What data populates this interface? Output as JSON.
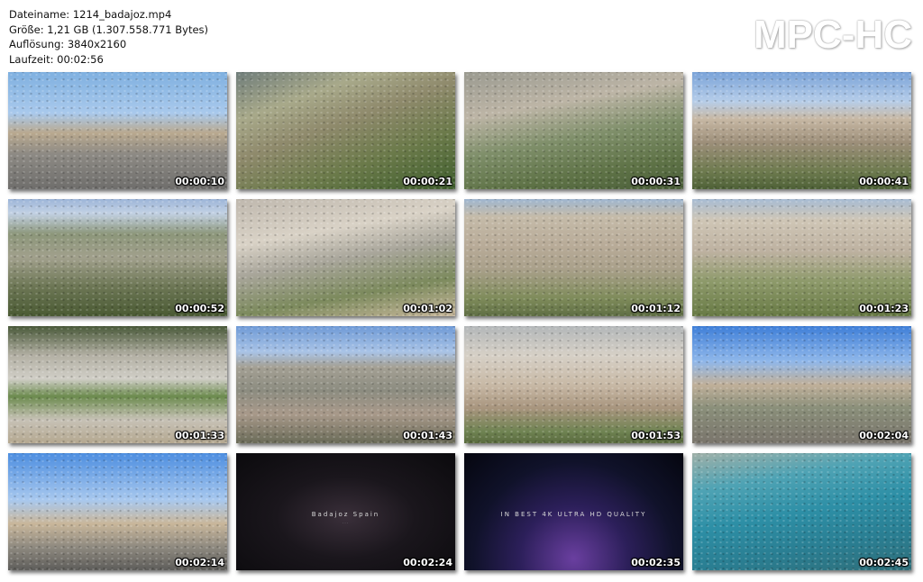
{
  "info": {
    "filename": "Dateiname: 1214_badajoz.mp4",
    "size": "Größe: 1,21 GB (1.307.558.771 Bytes)",
    "resolution": "Auflösung: 3840x2160",
    "duration": "Laufzeit: 00:02:56"
  },
  "logo": "MPC-HC",
  "thumbnails": [
    {
      "time": "00:00:10",
      "scene": "city-gate-palms"
    },
    {
      "time": "00:00:21",
      "scene": "bridge-river"
    },
    {
      "time": "00:00:31",
      "scene": "roundabout-aerial"
    },
    {
      "time": "00:00:41",
      "scene": "city-panorama"
    },
    {
      "time": "00:00:52",
      "scene": "river-bridge-wide"
    },
    {
      "time": "00:01:02",
      "scene": "gate-aerial"
    },
    {
      "time": "00:01:12",
      "scene": "city-aerial"
    },
    {
      "time": "00:01:23",
      "scene": "city-aerial-2"
    },
    {
      "time": "00:01:33",
      "scene": "promenade-top-down"
    },
    {
      "time": "00:01:43",
      "scene": "river-city-wide"
    },
    {
      "time": "00:01:53",
      "scene": "old-town-aerial"
    },
    {
      "time": "00:02:04",
      "scene": "plaza-palms"
    },
    {
      "time": "00:02:14",
      "scene": "gate-palms-low"
    },
    {
      "time": "00:02:24",
      "scene": "title-card",
      "caption": "Badajoz Spain",
      "subcaption": "..."
    },
    {
      "time": "00:02:35",
      "scene": "title-card-stars",
      "caption": "IN BEST 4K ULTRA HD QUALITY"
    },
    {
      "time": "00:02:45",
      "scene": "harbor-boats"
    }
  ]
}
